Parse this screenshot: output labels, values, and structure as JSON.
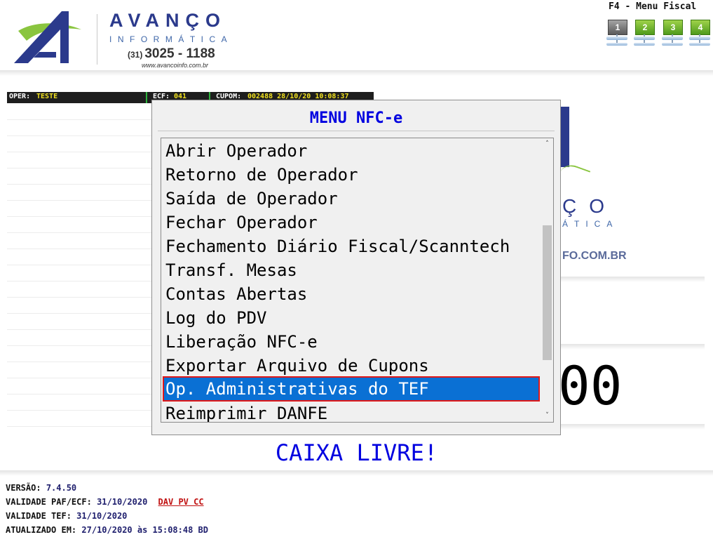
{
  "logo": {
    "brand": "AVANÇO",
    "sub": "INFORMÁTICA",
    "phone_ddd": "(31)",
    "phone_number": "3025 - 1188",
    "site": "www.avancoinfo.com.br"
  },
  "fiscal_menu": {
    "label": "F4 - Menu Fiscal",
    "buttons": [
      "1",
      "2",
      "3",
      "4"
    ]
  },
  "infobar": {
    "oper_label": "OPER:",
    "oper_value": "TESTE",
    "ecf_label": "ECF:",
    "ecf_value": "041",
    "cupom_label": "CUPOM:",
    "cupom_value": "002488 28/10/20 10:08:37"
  },
  "background": {
    "brand": "ÇO",
    "brand_sub": "ÁTICA",
    "site": "FO.COM.BR",
    "total": "00"
  },
  "modal": {
    "title": "MENU NFC-e",
    "items": [
      "Abrir Operador",
      "Retorno de Operador",
      "Saída de Operador",
      "Fechar Operador",
      "Fechamento Diário Fiscal/Scanntech",
      "Transf. Mesas",
      "Contas Abertas",
      "Log do PDV",
      "Liberação NFC-e",
      "Exportar Arquivo de Cupons",
      "Op. Administrativas do TEF",
      "Reimprimir DANFE"
    ],
    "selected_index": 10,
    "scroll_up": "˄",
    "scroll_down": "˅"
  },
  "status": {
    "caixa": "CAIXA LIVRE!"
  },
  "footer": {
    "versao_label": "VERSÃO:",
    "versao_value": "7.4.50",
    "paf_label": "VALIDADE PAF/ECF:",
    "paf_value": "31/10/2020",
    "dav_label": "DAV PV CC",
    "tef_label": "VALIDADE TEF:",
    "tef_value": "31/10/2020",
    "atualizado_label": "ATUALIZADO EM:",
    "atualizado_value": "27/10/2020 às 15:08:48 BD"
  },
  "colors": {
    "accent_blue": "#0000e0",
    "brand_navy": "#2b3a8c",
    "selection": "#0a70d4",
    "selection_border": "#e01818",
    "highlight_yellow": "#f0e020"
  }
}
